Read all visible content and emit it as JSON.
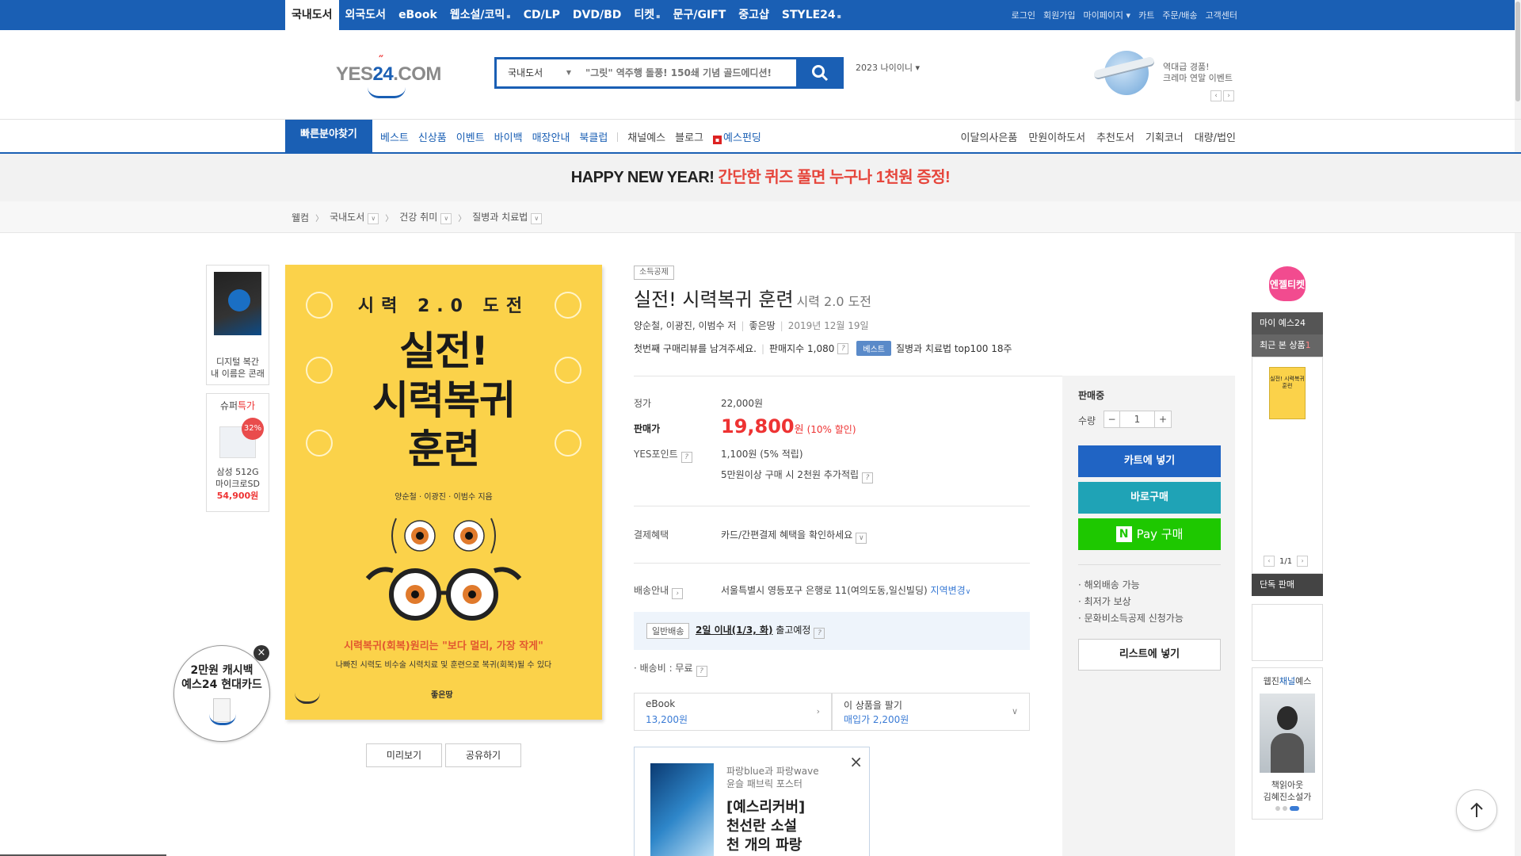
{
  "top_nav": {
    "categories": [
      {
        "label": "국내도서",
        "active": true
      },
      {
        "label": "외국도서"
      },
      {
        "label": "eBook"
      },
      {
        "label": "웹소설/코믹",
        "mark": "▪"
      },
      {
        "label": "CD/LP"
      },
      {
        "label": "DVD/BD"
      },
      {
        "label": "티켓",
        "mark": "▪"
      },
      {
        "label": "문구/GIFT"
      },
      {
        "label": "중고샵"
      },
      {
        "label": "STYLE24",
        "mark": "▪"
      }
    ],
    "utility": [
      "로그인",
      "회원가입",
      "마이페이지 ▾",
      "카트",
      "주문/배송",
      "고객센터"
    ]
  },
  "header": {
    "logo": {
      "text_main": "YES",
      "text_num": "24",
      "text_suffix": ".COM"
    },
    "search": {
      "category": "국내도서",
      "placeholder": "\"그릿\" 역주행 돌풍! 150쇄 기념 골드에디션!"
    },
    "naeo_text": "2023 나이이니 ▾",
    "promo": {
      "line1": "역대급 경품!",
      "line2": "크레마 연말 이벤트"
    }
  },
  "gnb": {
    "quick": "빠른분야찾기",
    "left_blue": [
      "베스트",
      "신상품",
      "이벤트",
      "바이백",
      "매장안내",
      "북클럽"
    ],
    "left_gray": [
      "채널예스",
      "블로그"
    ],
    "fund": "예스펀딩",
    "right": [
      "이달의사은품",
      "만원이하도서",
      "추천도서",
      "기획코너",
      "대량/법인"
    ]
  },
  "banner": {
    "part1": "HAPPY NEW YEAR!",
    "part2": " 간단한 퀴즈 풀면 누구나 1천원 증정!"
  },
  "breadcrumb": [
    "웰컴",
    "국내도서",
    "건강 취미",
    "질병과 치료법"
  ],
  "left_side": {
    "card1_text": [
      "디지털 복간",
      "내 이름은 콘래"
    ],
    "card2": {
      "head_plain": "슈퍼",
      "head_red": "특가",
      "badge": "32%",
      "name": [
        "삼성 512G",
        "마이크로SD"
      ],
      "price": "54,900원"
    }
  },
  "cashback": {
    "line1": "2만원 캐시백",
    "line2": "예스24 현대카드",
    "close": "×"
  },
  "cover": {
    "series": "시력 2.0 도전",
    "title": [
      "실전!",
      "시력복귀",
      "훈련"
    ],
    "author": "양순철 · 이광진 · 이범수 지음",
    "sub1": "시력복귀(회복)원리는 \"보다 멀리, 가장 작게\"",
    "sub2": "나빠진 시력도 비수술 시력치료 및 훈련으로 복귀(회복)될 수 있다",
    "publisher": "좋은땅"
  },
  "preview_buttons": {
    "preview": "미리보기",
    "share": "공유하기"
  },
  "product": {
    "tag": "소득공제",
    "title": "실전! 시력복귀 훈련",
    "subtitle": "시력 2.0 도전",
    "authors": "양순철, 이광진, 이범수 저",
    "publisher": "좋은땅",
    "date": "2019년 12월 19일",
    "review_prompt": "첫번째 구매리뷰를 남겨주세요.",
    "sales_index": "판매지수 1,080",
    "best_badge": "베스트",
    "best_rank": "질병과 치료법 top100 18주"
  },
  "pricing": {
    "list_label": "정가",
    "list_price": "22,000원",
    "sale_label": "판매가",
    "sale_price": "19,800",
    "sale_unit": "원",
    "discount": "(10% 할인)",
    "points_label": "YES포인트",
    "points": "1,100원 (5% 적립)",
    "points_extra": "5만원이상 구매 시 2천원 추가적립",
    "benefit_label": "결제혜택",
    "benefit": "카드/간편결제 혜택을 확인하세요",
    "ship_label": "배송안내",
    "ship_address": "서울특별시 영등포구 은행로 11(여의도동,일신빌딩)",
    "ship_change": "지역변경",
    "ship_type": "일반배송",
    "ship_date": "2일 이내(1/3, 화)",
    "ship_suffix": " 출고예정",
    "ship_fee": "· 배송비 : 무료"
  },
  "ebook_box": {
    "label": "eBook",
    "price": "13,200원"
  },
  "sell_box": {
    "label": "이 상품을 팔기",
    "price": "매입가 2,200원"
  },
  "ad": {
    "line1": "파랑blue과 파랑wave",
    "line2": "윤슬 패브릭 포스터",
    "title": [
      "[예스리커버]",
      "천선란 소설",
      "천 개의 파랑"
    ],
    "close": "×"
  },
  "buy_box": {
    "status": "판매중",
    "qty_label": "수량",
    "qty": "1",
    "cart": "카트에 넣기",
    "buy_now": "바로구매",
    "npay": "Pay 구매",
    "notes": [
      "· 해외배송 가능",
      "· 최저가 보상",
      "· 문화비소득공제 신청가능"
    ],
    "wishlist": "리스트에 넣기"
  },
  "right_rail": {
    "angel": "엔젤티켓",
    "my24": "마이 예스24",
    "recent_label": "최근 본 상품",
    "recent_count": "1",
    "recent_thumb": "실전! 시력복귀 훈련",
    "pager": "1/1",
    "only": "단독 판매",
    "channel_head_plain": "웹진",
    "channel_head_blue": "채널",
    "channel_head_tail": "예스",
    "channel_name": [
      "책읽아웃",
      "김혜진소설가"
    ]
  },
  "colors": {
    "brand_blue": "#1a5fb4",
    "sale_red": "#e33333",
    "cover_yellow": "#fbd24a",
    "npay_green": "#1ec800"
  }
}
